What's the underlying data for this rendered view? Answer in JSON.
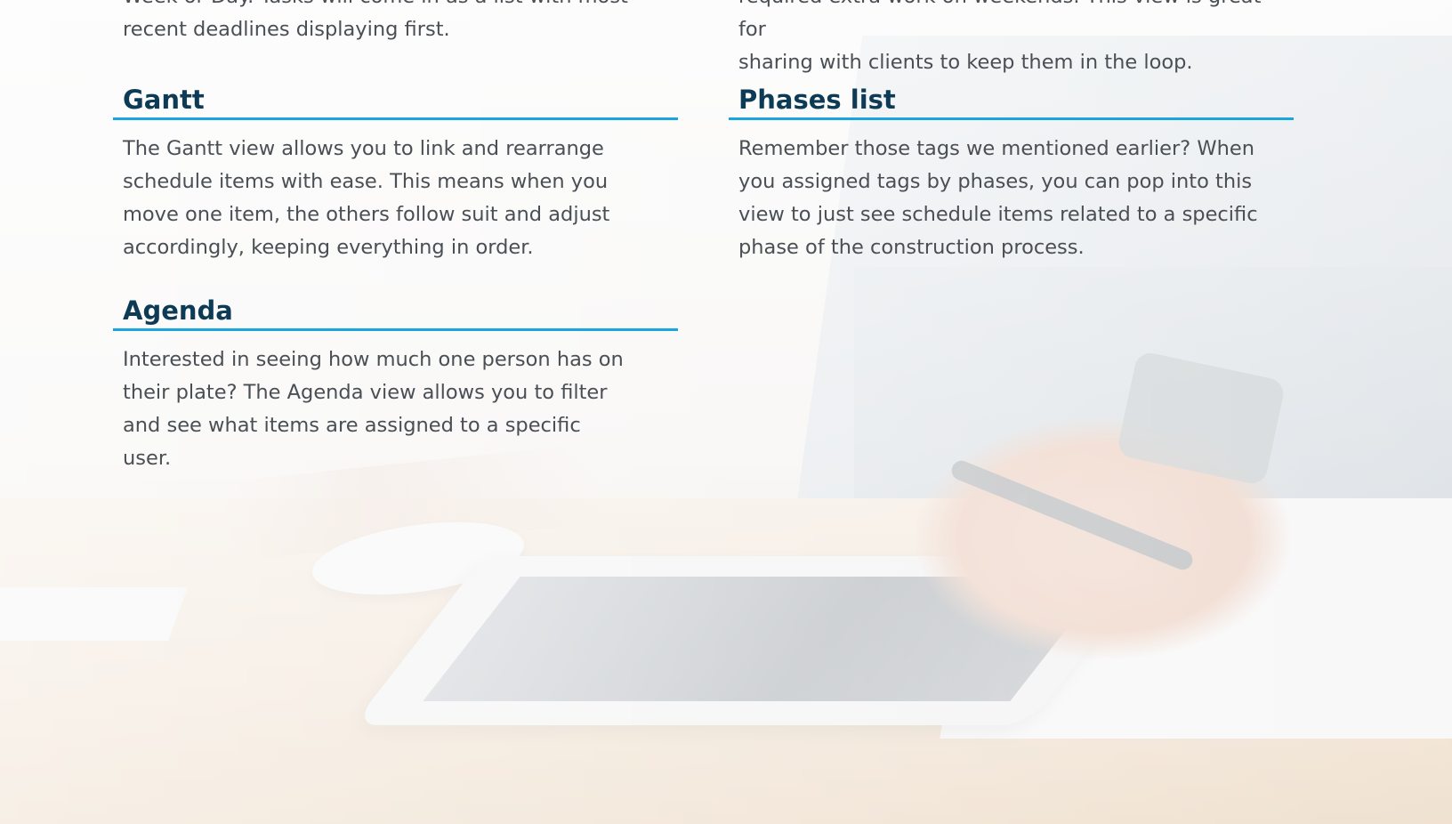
{
  "top_fragments": {
    "left_line1": "Week or Day. Tasks will come in as a list with most",
    "left_line2": "recent deadlines displaying first.",
    "right_line1": "required extra work on weekends. This view is great for",
    "right_line2": "sharing with clients to keep them in the loop."
  },
  "sections": {
    "gantt": {
      "title": "Gantt",
      "body": "The Gantt view allows you to link and rearrange schedule items with ease. This means when you move one item, the others follow suit and adjust accordingly, keeping everything in order."
    },
    "phases_list": {
      "title": "Phases list",
      "body": "Remember those tags we mentioned earlier? When you assigned tags by phases, you can pop into this view to just see schedule items related to a specific phase of the construction process."
    },
    "agenda": {
      "title": "Agenda",
      "body": "Interested in seeing how much one person has on their plate? The Agenda view allows you to filter and see what items are assigned to a specific user."
    }
  },
  "colors": {
    "heading": "#0d3b56",
    "rule": "#19a6dc",
    "body_text": "#4a4f55"
  }
}
